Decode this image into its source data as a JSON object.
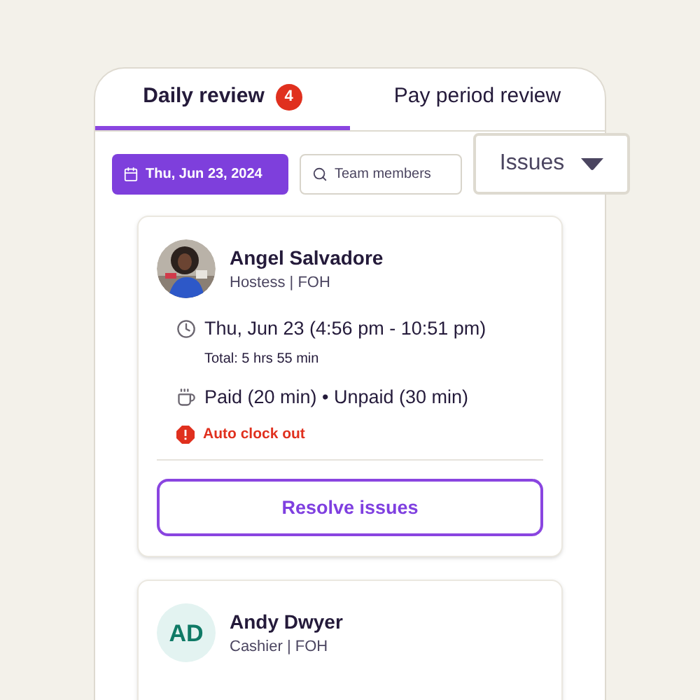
{
  "tabs": [
    {
      "label": "Daily review",
      "badge": "4",
      "selected": true
    },
    {
      "label": "Pay period review",
      "selected": false
    }
  ],
  "filters": {
    "date": "Thu, Jun 23, 2024",
    "search_placeholder": "Team members",
    "dropdown": "Issues"
  },
  "cards": [
    {
      "name": "Angel Salvadore",
      "role": "Hostess | FOH",
      "shift": "Thu, Jun 23 (4:56 pm - 10:51 pm)",
      "total": "Total: 5 hrs 55 min",
      "breaks": "Paid (20 min) • Unpaid (30 min)",
      "issue": "Auto clock out",
      "action": "Resolve issues"
    },
    {
      "name": "Andy Dwyer",
      "role": "Cashier | FOH",
      "avatar": {
        "kind": "initials",
        "initials": "AD"
      }
    }
  ]
}
